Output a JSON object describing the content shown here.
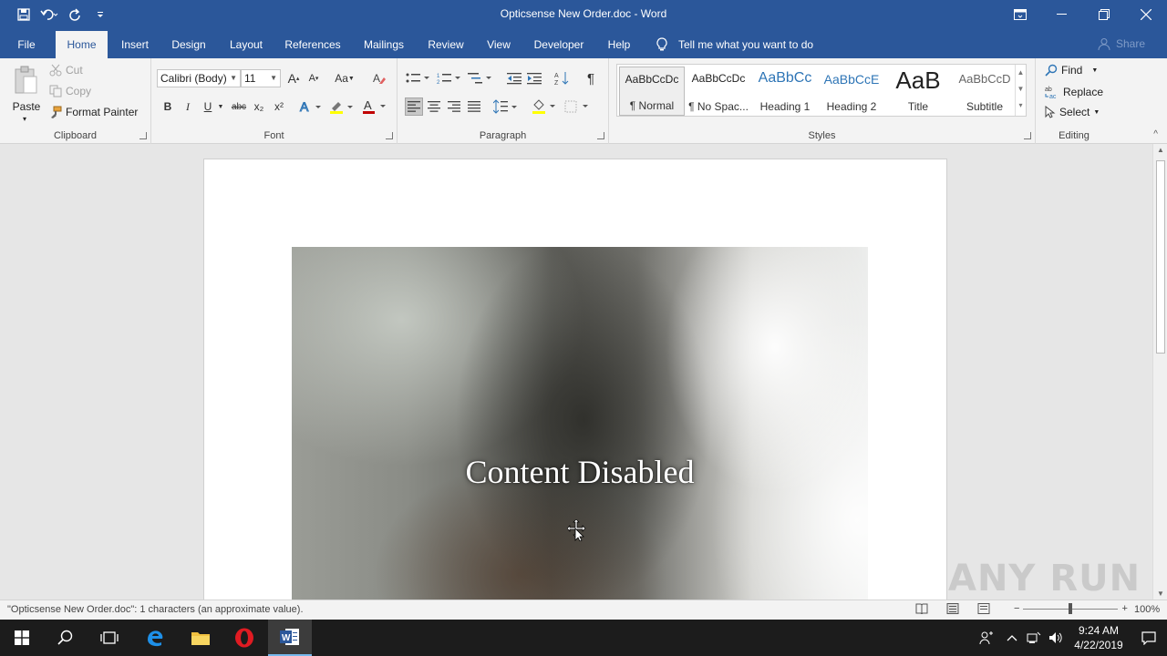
{
  "window": {
    "title": "Opticsense New Order.doc  -  Word"
  },
  "qat": {
    "icons": [
      "save-icon",
      "undo-icon",
      "redo-icon",
      "customize-icon"
    ]
  },
  "tabs": [
    "File",
    "Home",
    "Insert",
    "Design",
    "Layout",
    "References",
    "Mailings",
    "Review",
    "View",
    "Developer",
    "Help"
  ],
  "active_tab": "Home",
  "tell_me": "Tell me what you want to do",
  "share": "Share",
  "clipboard": {
    "paste": "Paste",
    "cut": "Cut",
    "copy": "Copy",
    "format_painter": "Format Painter",
    "label": "Clipboard"
  },
  "font": {
    "name": "Calibri (Body)",
    "size": "11",
    "label": "Font",
    "bold": "B",
    "italic": "I",
    "underline": "U",
    "strike": "abc",
    "subscript": "x₂",
    "superscript": "x²",
    "grow": "A",
    "shrink": "A",
    "change_case": "Aa",
    "font_color": "A"
  },
  "paragraph": {
    "label": "Paragraph"
  },
  "styles": {
    "label": "Styles",
    "items": [
      {
        "preview": "AaBbCcDc",
        "name": "¶ Normal"
      },
      {
        "preview": "AaBbCcDc",
        "name": "¶ No Spac..."
      },
      {
        "preview": "AaBbCc",
        "name": "Heading 1"
      },
      {
        "preview": "AaBbCcE",
        "name": "Heading 2"
      },
      {
        "preview": "AaB",
        "name": "Title"
      },
      {
        "preview": "AaBbCcD",
        "name": "Subtitle"
      }
    ]
  },
  "editing": {
    "find": "Find",
    "replace": "Replace",
    "select": "Select",
    "label": "Editing"
  },
  "document": {
    "image_text": "Content Disabled"
  },
  "status": {
    "message": "\"Opticsense New Order.doc\": 1 characters (an approximate value).",
    "zoom": "100%",
    "zoom_level_percent": 100
  },
  "taskbar": {
    "time": "9:24 AM",
    "date": "4/22/2019"
  },
  "watermark": "ANY RUN",
  "colors": {
    "word_blue": "#2b579a",
    "ribbon_bg": "#f3f3f3",
    "taskbar_bg": "#1c1c1c"
  }
}
